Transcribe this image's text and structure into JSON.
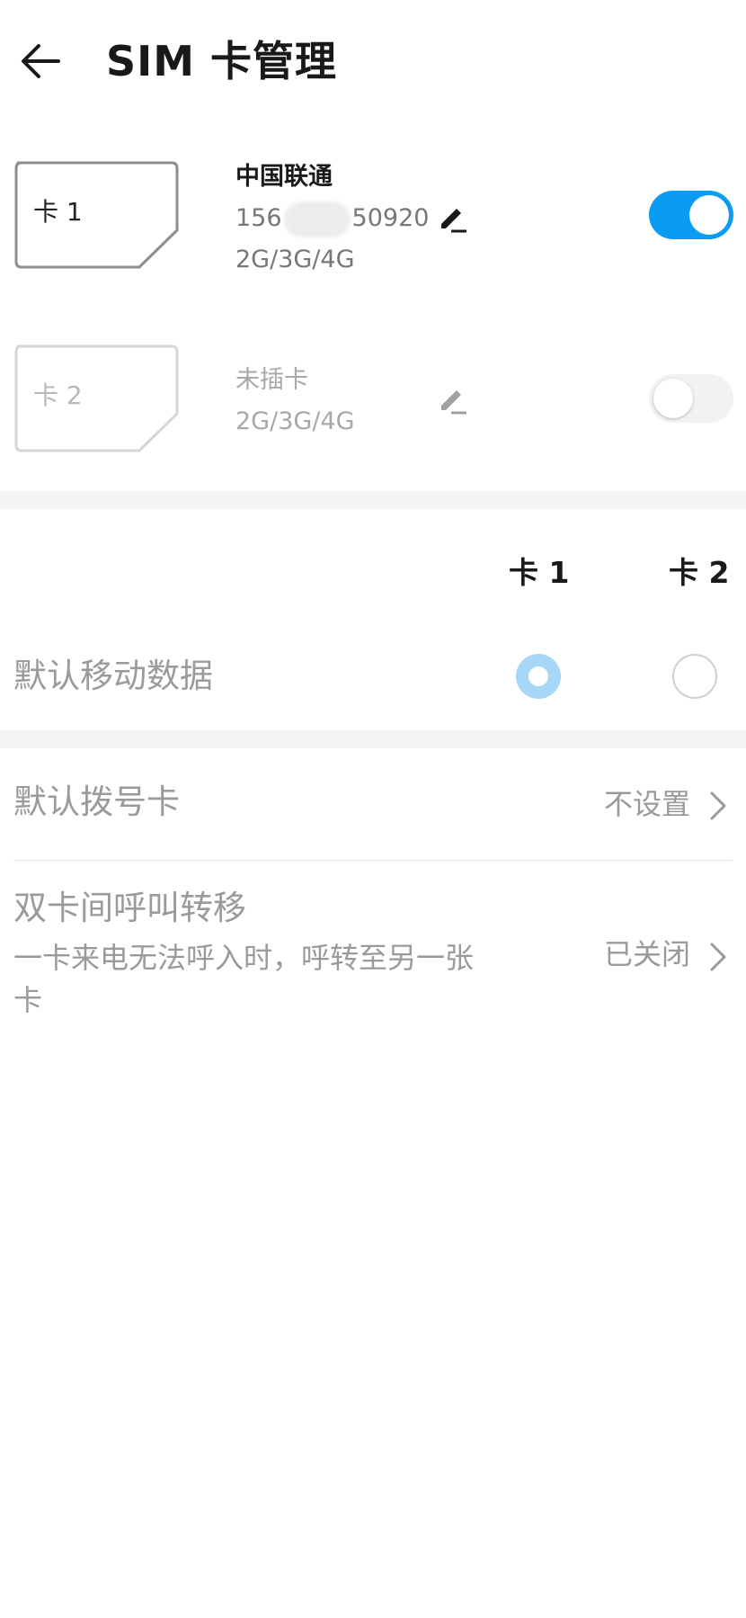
{
  "header": {
    "title": "SIM 卡管理",
    "back_icon": "arrow-left-icon"
  },
  "sims": [
    {
      "label": "卡 1",
      "carrier": "中国联通",
      "number_prefix": "156",
      "number_suffix": "50920",
      "network": "2G/3G/4G",
      "enabled": true
    },
    {
      "label": "卡 2",
      "carrier": "未插卡",
      "network": "2G/3G/4G",
      "enabled": false
    }
  ],
  "data_section": {
    "col1": "卡 1",
    "col2": "卡 2",
    "title": "默认移动数据",
    "selected": "卡 1"
  },
  "dial_card": {
    "title": "默认拨号卡",
    "value": "不设置"
  },
  "forwarding": {
    "title": "双卡间呼叫转移",
    "subtitle": "一卡来电无法呼入时，呼转至另一张卡",
    "value": "已关闭"
  },
  "colors": {
    "accent": "#0a9cf2",
    "radio_selected": "#a7d7f6",
    "secondary_text": "#9a9a9a"
  }
}
